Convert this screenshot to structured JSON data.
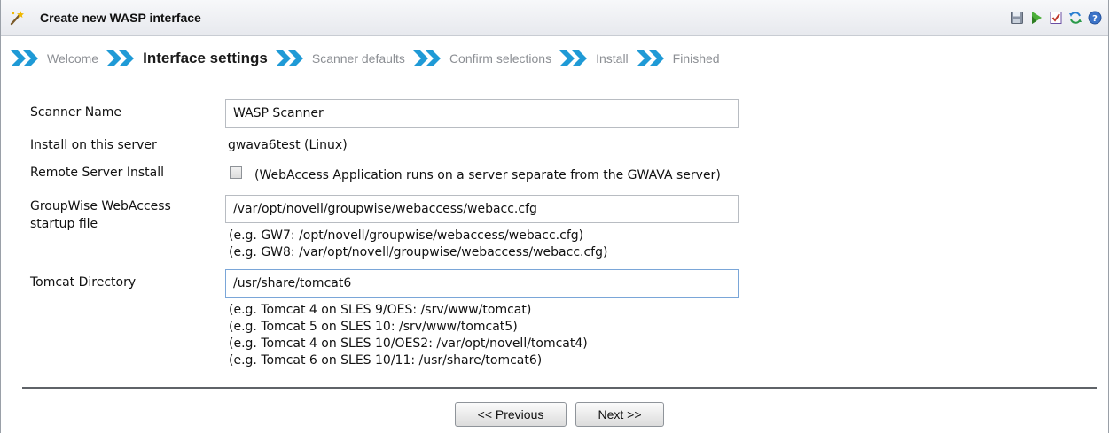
{
  "window": {
    "title": "Create new WASP interface",
    "title_icon": "wizard-wand-icon",
    "toolbar_icons": [
      "save-icon",
      "run-icon",
      "checklist-icon",
      "refresh-icon",
      "help-icon"
    ]
  },
  "wizard": {
    "steps": [
      {
        "label": "Welcome",
        "current": false
      },
      {
        "label": "Interface settings",
        "current": true
      },
      {
        "label": "Scanner defaults",
        "current": false
      },
      {
        "label": "Confirm selections",
        "current": false
      },
      {
        "label": "Install",
        "current": false
      },
      {
        "label": "Finished",
        "current": false
      }
    ],
    "accent_color": "#1f9ad6"
  },
  "form": {
    "scanner_name": {
      "label": "Scanner Name",
      "value": "WASP Scanner"
    },
    "install_server": {
      "label": "Install on this server",
      "value": "gwava6test (Linux)"
    },
    "remote_install": {
      "label": "Remote Server Install",
      "checked": false,
      "description": "(WebAccess Application runs on a server separate from the GWAVA server)"
    },
    "webaccess_file": {
      "label_line1": "GroupWise WebAccess",
      "label_line2": "startup file",
      "value": "/var/opt/novell/groupwise/webaccess/webacc.cfg",
      "hints": [
        "(e.g. GW7: /opt/novell/groupwise/webaccess/webacc.cfg)",
        "(e.g. GW8: /var/opt/novell/groupwise/webaccess/webacc.cfg)"
      ]
    },
    "tomcat_dir": {
      "label": "Tomcat Directory",
      "value": "/usr/share/tomcat6",
      "hints": [
        "(e.g. Tomcat 4 on SLES 9/OES: /srv/www/tomcat)",
        "(e.g. Tomcat 5 on SLES 10: /srv/www/tomcat5)",
        "(e.g. Tomcat 4 on SLES 10/OES2: /var/opt/novell/tomcat4)",
        "(e.g. Tomcat 6 on SLES 10/11: /usr/share/tomcat6)"
      ]
    }
  },
  "buttons": {
    "previous": "<< Previous",
    "next": "Next >>"
  }
}
